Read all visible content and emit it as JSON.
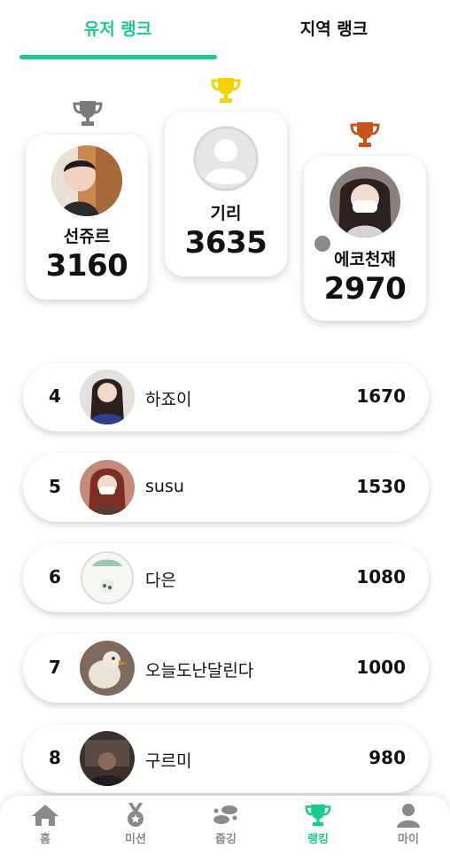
{
  "tabs": {
    "user_rank": "유저 랭크",
    "region_rank": "지역 랭크"
  },
  "podium": {
    "first": {
      "name": "기리",
      "score": "3635"
    },
    "second": {
      "name": "선쥬르",
      "score": "3160"
    },
    "third": {
      "name": "에코천재",
      "score": "2970"
    }
  },
  "ranks": [
    {
      "rank": "4",
      "name": "하죠이",
      "score": "1670"
    },
    {
      "rank": "5",
      "name": "susu",
      "score": "1530"
    },
    {
      "rank": "6",
      "name": "다은",
      "score": "1080"
    },
    {
      "rank": "7",
      "name": "오늘도난달린다",
      "score": "1000"
    },
    {
      "rank": "8",
      "name": "구르미",
      "score": "980"
    }
  ],
  "nav": {
    "home": "홈",
    "mission": "미션",
    "plogging": "줍깅",
    "ranking": "랭킹",
    "my": "마이"
  },
  "colors": {
    "accent": "#1ec98f",
    "gold": "#f5d200",
    "silver": "#7a7a7a",
    "bronze": "#c8531b",
    "nav_inactive": "#8a8a8a"
  },
  "icons": {
    "trophy": "trophy-icon",
    "home": "home-icon",
    "mission": "medal-icon",
    "plogging": "footprints-icon",
    "ranking": "trophy-icon",
    "my": "person-icon"
  }
}
